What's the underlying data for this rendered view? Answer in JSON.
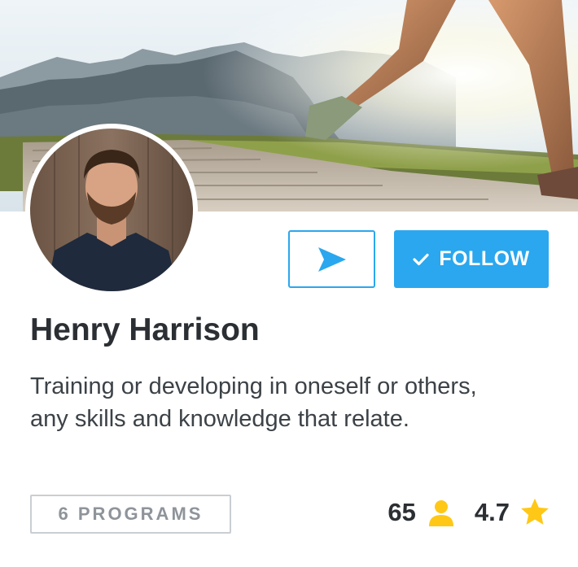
{
  "profile": {
    "name": "Henry Harrison",
    "bio": "Training or developing in oneself or others, any skills and knowledge that relate."
  },
  "actions": {
    "send_icon": "paper-plane-icon",
    "follow_icon": "check-icon",
    "follow_label": "FOLLOW"
  },
  "programs": {
    "label": "6 PROGRAMS"
  },
  "stats": {
    "followers": "65",
    "followers_icon": "user-icon",
    "rating": "4.7",
    "rating_icon": "star-icon"
  },
  "colors": {
    "accent": "#2AA7EE",
    "star": "#FFC816",
    "text_dark": "#2B2F33",
    "border_gray": "#C9CED3"
  }
}
